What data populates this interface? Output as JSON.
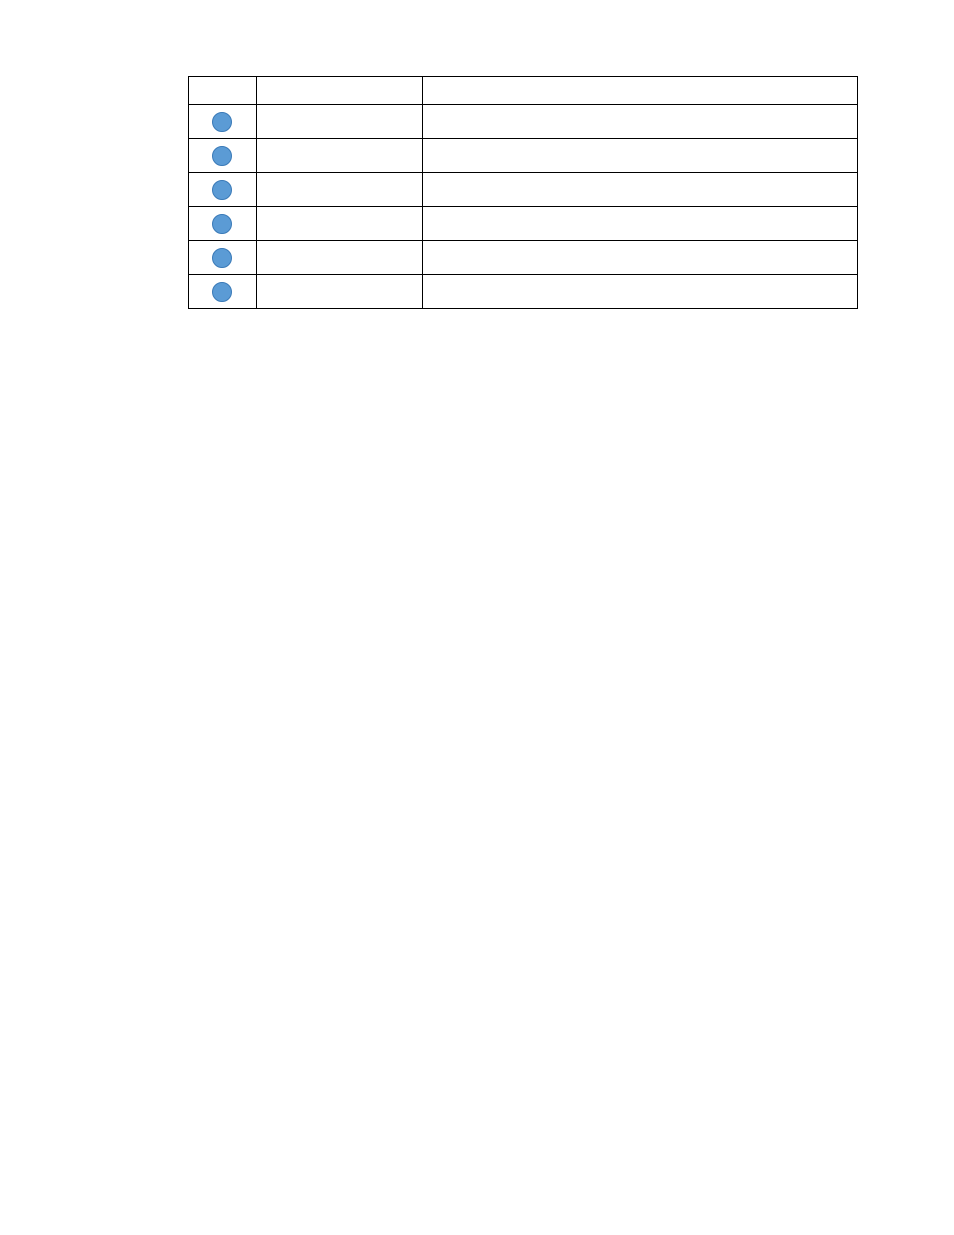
{
  "table": {
    "header": {
      "col1": "",
      "col2": "",
      "col3": ""
    },
    "rows": [
      {
        "hasDot": true,
        "col2": "",
        "col3": ""
      },
      {
        "hasDot": true,
        "col2": "",
        "col3": ""
      },
      {
        "hasDot": true,
        "col2": "",
        "col3": ""
      },
      {
        "hasDot": true,
        "col2": "",
        "col3": ""
      },
      {
        "hasDot": true,
        "col2": "",
        "col3": ""
      },
      {
        "hasDot": true,
        "col2": "",
        "col3": ""
      }
    ]
  },
  "dotColor": "#5b9bd5"
}
